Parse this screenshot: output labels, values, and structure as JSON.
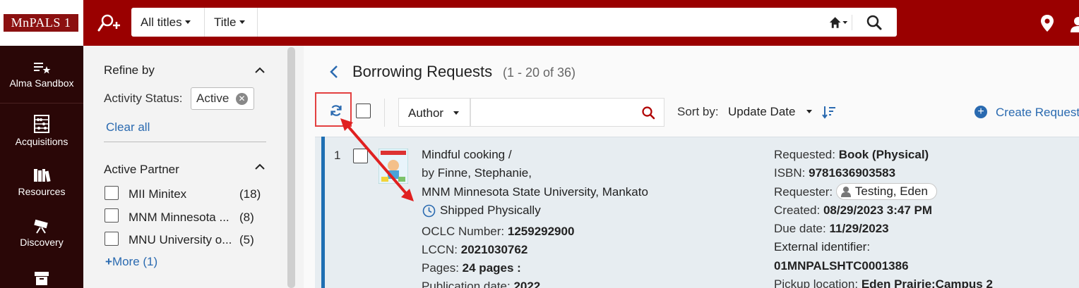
{
  "topbar": {
    "logo_text": "MnPALS 1",
    "search_scope": "All titles",
    "search_field": "Title",
    "search_value": ""
  },
  "leftnav": {
    "items": [
      {
        "label": "Alma Sandbox",
        "icon": "star-list-icon"
      },
      {
        "label": "Acquisitions",
        "icon": "abacus-icon"
      },
      {
        "label": "Resources",
        "icon": "books-icon"
      },
      {
        "label": "Discovery",
        "icon": "telescope-icon"
      },
      {
        "label": "",
        "icon": "archive-icon"
      }
    ]
  },
  "facets": {
    "refine_title": "Refine by",
    "activity_label": "Activity Status:",
    "activity_value": "Active",
    "clear_all": "Clear all",
    "partner_title": "Active Partner",
    "partners": [
      {
        "label": "MII Minitex",
        "count": "(18)"
      },
      {
        "label": "MNM Minnesota ...",
        "count": "(8)"
      },
      {
        "label": "MNU University o...",
        "count": "(5)"
      }
    ],
    "more": "More (1)"
  },
  "main": {
    "title": "Borrowing Requests",
    "count": "(1 - 20 of 36)",
    "filter_field": "Author",
    "filter_value": "",
    "sort_label": "Sort by:",
    "sort_value": "Update Date",
    "create_label": "Create Request"
  },
  "result": {
    "index": "1",
    "title": "Mindful cooking /",
    "by_prefix": "by",
    "author": "Finne, Stephanie,",
    "library": "MNM Minnesota State University, Mankato",
    "status": "Shipped Physically",
    "oclc_label": "OCLC Number:",
    "oclc": "1259292900",
    "lccn_label": "LCCN:",
    "lccn": "2021030762",
    "pages_label": "Pages:",
    "pages": "24 pages :",
    "pubdate_label": "Publication date:",
    "pubdate": "2022",
    "requested_label": "Requested:",
    "requested": "Book (Physical)",
    "isbn_label": "ISBN:",
    "isbn": "9781636903583",
    "requester_label": "Requester:",
    "requester": "Testing, Eden",
    "created_label": "Created:",
    "created": "08/29/2023 3:47 PM",
    "due_label": "Due date:",
    "due": "11/29/2023",
    "extid_label": "External identifier:",
    "extid": "01MNPALSHTC0001386",
    "pickup_label": "Pickup location:",
    "pickup": "Eden Prairie:Campus 2"
  },
  "colors": {
    "topbar": "#9a0000",
    "leftnav": "#2a0707",
    "link": "#2a6ab0",
    "row_accent": "#1f6fb3",
    "annotation": "#e02020"
  }
}
